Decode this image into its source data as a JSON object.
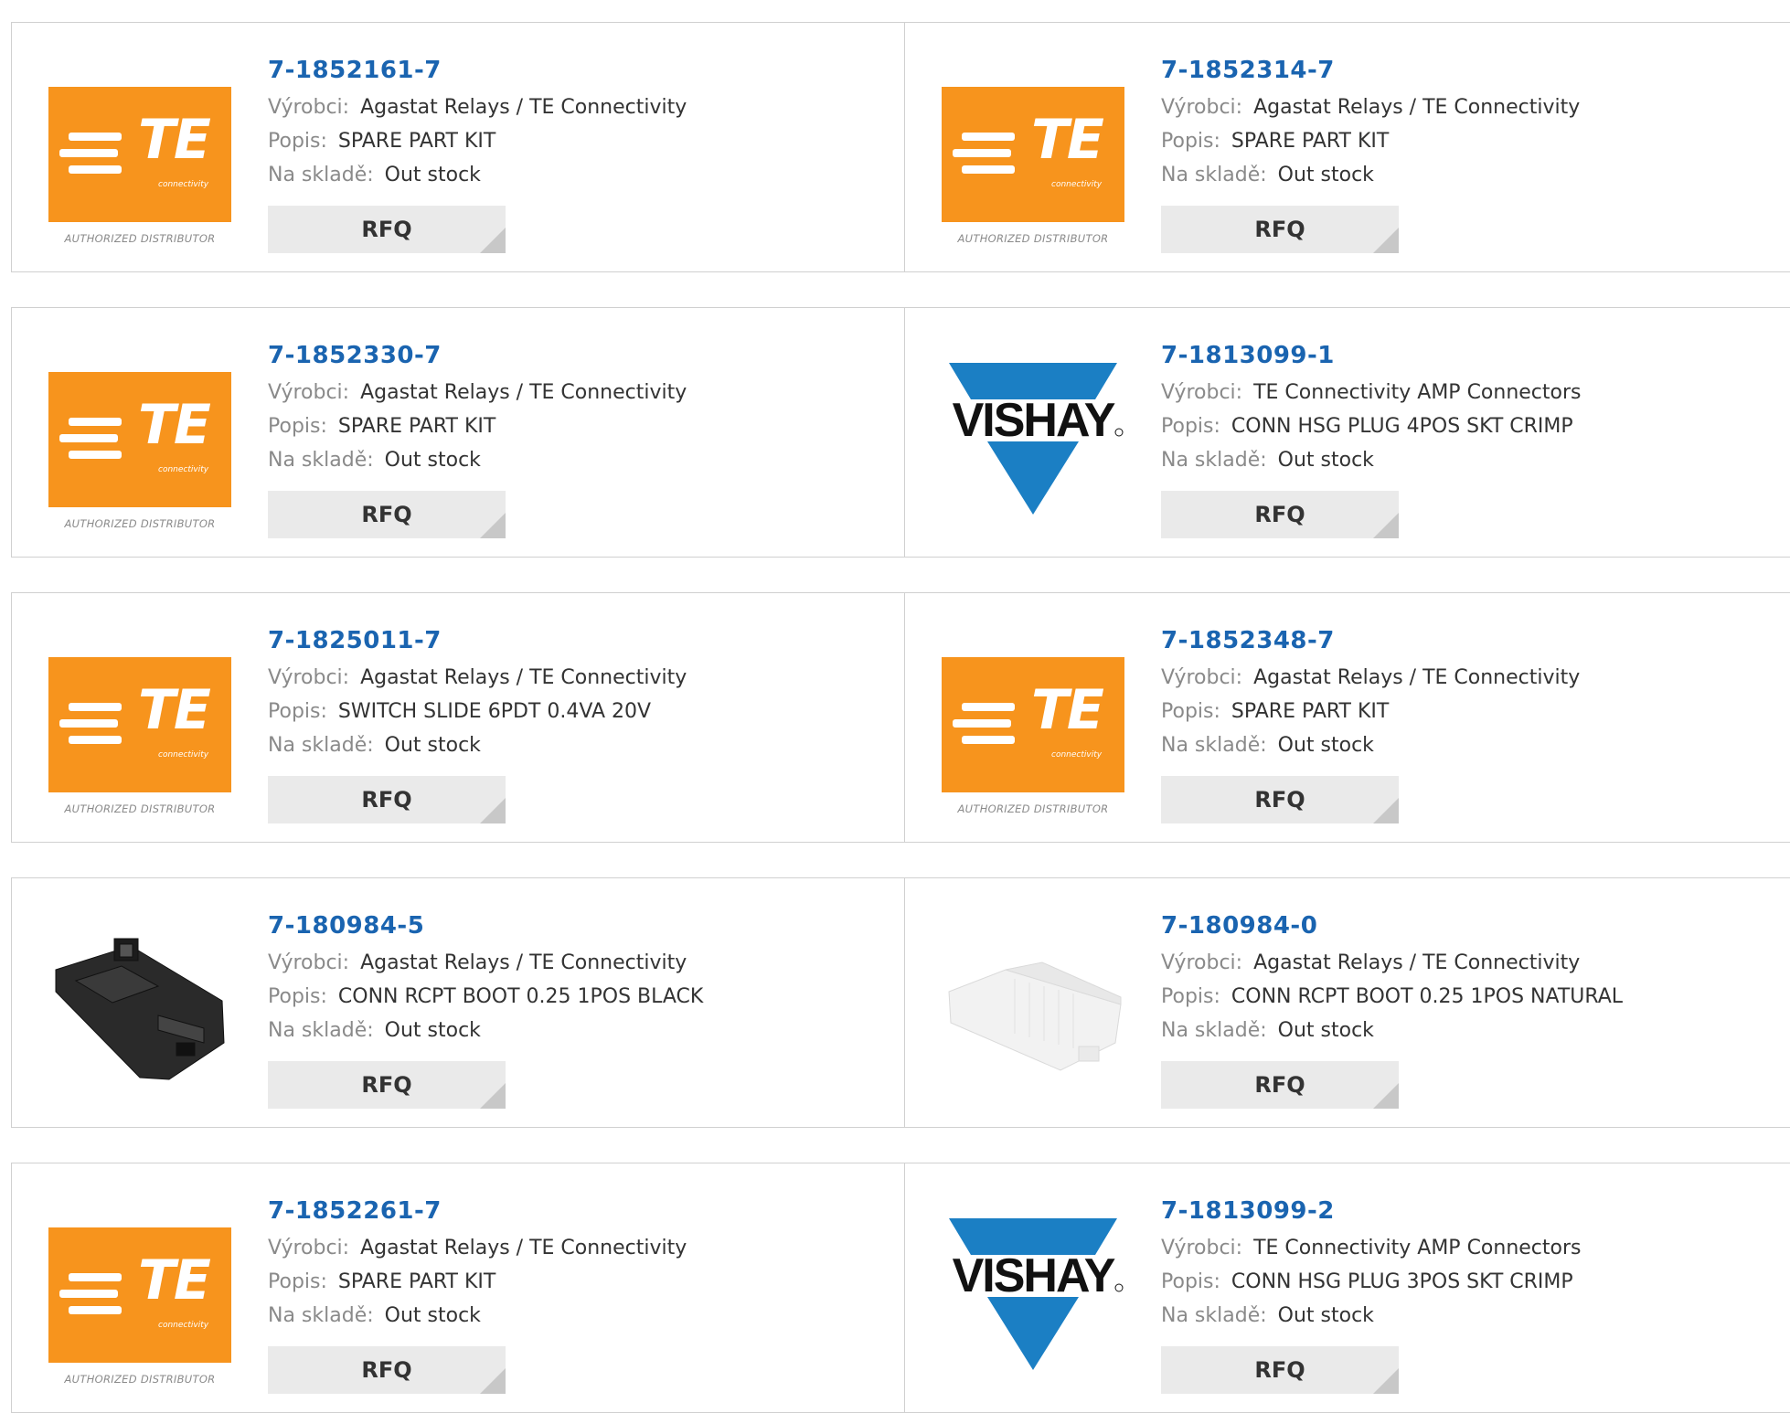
{
  "labels": {
    "manufacturer": "Výrobci:",
    "description": "Popis:",
    "stock": "Na skladě:",
    "rfq": "RFQ"
  },
  "te_logo": {
    "letters": "TE",
    "subtext": "connectivity",
    "authorized": "AUTHORIZED DISTRIBUTOR"
  },
  "vishay_logo": {
    "text": "VISHAY",
    "color": "#1b7fc4"
  },
  "colors": {
    "te_orange": "#f7941d",
    "part_link": "#1a64b0"
  },
  "products": [
    {
      "part": "7-1852161-7",
      "manufacturer": "Agastat Relays / TE Connectivity",
      "description": "SPARE PART KIT",
      "stock": "Out stock",
      "logo": "te"
    },
    {
      "part": "7-1852314-7",
      "manufacturer": "Agastat Relays / TE Connectivity",
      "description": "SPARE PART KIT",
      "stock": "Out stock",
      "logo": "te"
    },
    {
      "part": "7-1852330-7",
      "manufacturer": "Agastat Relays / TE Connectivity",
      "description": "SPARE PART KIT",
      "stock": "Out stock",
      "logo": "te"
    },
    {
      "part": "7-1813099-1",
      "manufacturer": "TE Connectivity AMP Connectors",
      "description": "CONN HSG PLUG 4POS SKT CRIMP",
      "stock": "Out stock",
      "logo": "vishay"
    },
    {
      "part": "7-1825011-7",
      "manufacturer": "Agastat Relays / TE Connectivity",
      "description": "SWITCH SLIDE 6PDT 0.4VA 20V",
      "stock": "Out stock",
      "logo": "te"
    },
    {
      "part": "7-1852348-7",
      "manufacturer": "Agastat Relays / TE Connectivity",
      "description": "SPARE PART KIT",
      "stock": "Out stock",
      "logo": "te"
    },
    {
      "part": "7-180984-5",
      "manufacturer": "Agastat Relays / TE Connectivity",
      "description": "CONN RCPT BOOT 0.25 1POS BLACK",
      "stock": "Out stock",
      "logo": "photo-black"
    },
    {
      "part": "7-180984-0",
      "manufacturer": "Agastat Relays / TE Connectivity",
      "description": "CONN RCPT BOOT 0.25 1POS NATURAL",
      "stock": "Out stock",
      "logo": "photo-natural"
    },
    {
      "part": "7-1852261-7",
      "manufacturer": "Agastat Relays / TE Connectivity",
      "description": "SPARE PART KIT",
      "stock": "Out stock",
      "logo": "te"
    },
    {
      "part": "7-1813099-2",
      "manufacturer": "TE Connectivity AMP Connectors",
      "description": "CONN HSG PLUG 3POS SKT CRIMP",
      "stock": "Out stock",
      "logo": "vishay"
    }
  ]
}
